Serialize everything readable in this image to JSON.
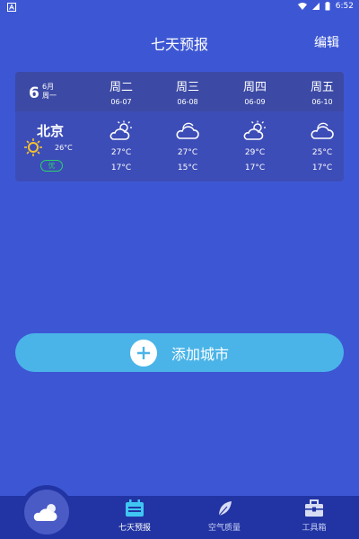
{
  "status_bar": {
    "time": "6:52",
    "battery": "x"
  },
  "header": {
    "title": "七天预报",
    "edit_label": "编辑"
  },
  "forecast_card": {
    "today": {
      "day": "6",
      "month": "6月",
      "weekday": "周一"
    },
    "days": [
      {
        "weekday": "周二",
        "date": "06-07",
        "icon": "sun-cloud-icon",
        "high": "27°C",
        "low": "17°C"
      },
      {
        "weekday": "周三",
        "date": "06-08",
        "icon": "cloud-icon",
        "high": "27°C",
        "low": "15°C"
      },
      {
        "weekday": "周四",
        "date": "06-09",
        "icon": "sun-cloud-icon",
        "high": "29°C",
        "low": "17°C"
      },
      {
        "weekday": "周五",
        "date": "06-10",
        "icon": "cloud-icon",
        "high": "25°C",
        "low": "17°C"
      }
    ],
    "city": {
      "name": "北京",
      "temp": "26°C",
      "aqi": "优",
      "icon": "sun-icon"
    }
  },
  "add_city": {
    "label": "添加城市"
  },
  "tabs": [
    {
      "label": "七天预报",
      "icon": "calendar-icon",
      "active": true
    },
    {
      "label": "空气质量",
      "icon": "leaf-icon",
      "active": false
    },
    {
      "label": "工具箱",
      "icon": "toolbox-icon",
      "active": false
    }
  ],
  "colors": {
    "background": "#3d57d4",
    "card": "#3d4db7",
    "button": "#4ab4e8",
    "tabbar": "#2234a3",
    "aqi_good": "#2bd16b"
  }
}
